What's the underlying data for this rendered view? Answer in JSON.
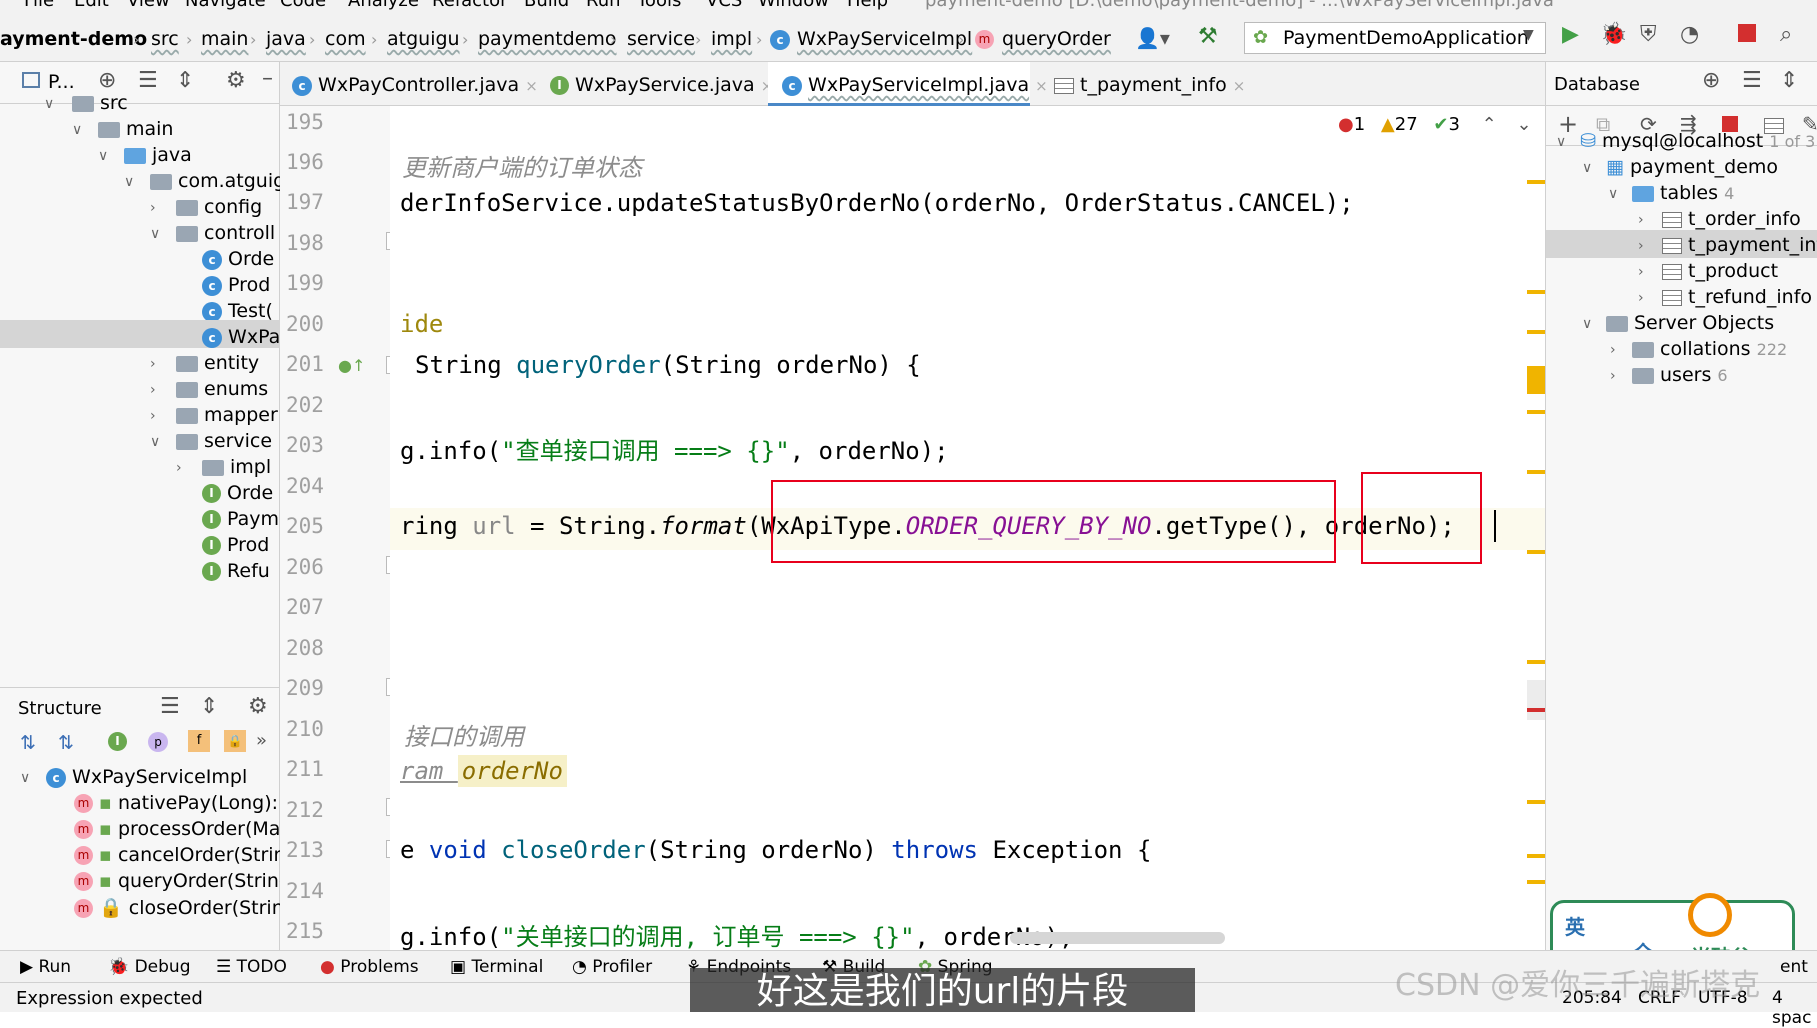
{
  "menubar": {
    "items": [
      "File",
      "Edit",
      "View",
      "Navigate",
      "Code",
      "Analyze",
      "Refactor",
      "Build",
      "Run",
      "Tools",
      "VCS",
      "Window",
      "Help"
    ],
    "title": "payment-demo [D:\\demo\\payment-demo] - ...\\WxPayServiceImpl.java"
  },
  "breadcrumb": {
    "items": [
      "ayment-demo",
      "src",
      "main",
      "java",
      "com",
      "atguigu",
      "paymentdemo",
      "service",
      "impl",
      "WxPayServiceImpl",
      "queryOrder"
    ]
  },
  "run_config": "PaymentDemoApplication",
  "project_panel": {
    "title": "P...",
    "tree": [
      {
        "label": "src",
        "depth": 0
      },
      {
        "label": "main",
        "depth": 1
      },
      {
        "label": "java",
        "depth": 2
      },
      {
        "label": "com.atguig",
        "depth": 3
      },
      {
        "label": "config",
        "depth": 4
      },
      {
        "label": "controll",
        "depth": 4
      },
      {
        "label": "Orde",
        "depth": 5
      },
      {
        "label": "Prod",
        "depth": 5
      },
      {
        "label": "Test(",
        "depth": 5
      },
      {
        "label": "WxPa",
        "depth": 5
      },
      {
        "label": "entity",
        "depth": 4
      },
      {
        "label": "enums",
        "depth": 4
      },
      {
        "label": "mapper",
        "depth": 4
      },
      {
        "label": "service",
        "depth": 4
      },
      {
        "label": "impl",
        "depth": 5
      },
      {
        "label": "Orde",
        "depth": 5
      },
      {
        "label": "Paym",
        "depth": 5
      },
      {
        "label": "Prod",
        "depth": 5
      },
      {
        "label": "Refu",
        "depth": 5
      }
    ]
  },
  "structure_panel": {
    "title": "Structure",
    "root": "WxPayServiceImpl",
    "members": [
      "nativePay(Long): I",
      "processOrder(Ma",
      "cancelOrder(Strin",
      "queryOrder(String",
      "closeOrder(String"
    ]
  },
  "editor": {
    "tabs": [
      "WxPayController.java",
      "WxPayService.java",
      "WxPayServiceImpl.java",
      "t_payment_info"
    ],
    "inspections": {
      "errors": "1",
      "warnings": "27",
      "ok": "3"
    },
    "line_numbers": [
      "195",
      "196",
      "197",
      "198",
      "199",
      "200",
      "201",
      "202",
      "203",
      "204",
      "205",
      "206",
      "207",
      "208",
      "209",
      "210",
      "211",
      "212",
      "213",
      "214",
      "215"
    ],
    "code": {
      "l196": "更新商户端的订单状态",
      "l197": "derInfoService.updateStatusByOrderNo(orderNo, OrderStatus.CANCEL);",
      "l200": "ide",
      "l201_kw": "String ",
      "l201_fn": "queryOrder",
      "l201_rest": "(String orderNo) {",
      "l203_a": "g.info(",
      "l203_str": "\"查单接口调用 ===> {}\"",
      "l203_b": ", orderNo);",
      "l205_a": "ring ",
      "l205_var": "url",
      "l205_b": " = String.",
      "l205_fmt": "format",
      "l205_c": "(WxApiType.",
      "l205_const": "ORDER_QUERY_BY_NO",
      "l205_d": ".getType(), orderNo);",
      "l210": "接口的调用",
      "l211_a": "ram ",
      "l211_b": "orderNo",
      "l213_a": "e ",
      "l213_kw": "void ",
      "l213_fn": "closeOrder",
      "l213_b": "(String orderNo) ",
      "l213_kw2": "throws",
      "l213_c": " Exception {",
      "l215_a": "g.info(",
      "l215_str": "\"关单接口的调用, 订单号 ===> {}\"",
      "l215_b": ", orderNo);"
    }
  },
  "database_panel": {
    "title": "Database",
    "connection": "mysql@localhost",
    "connection_count": "1 of 3",
    "schema": "payment_demo",
    "tables_label": "tables",
    "tables_count": "4",
    "tables": [
      "t_order_info",
      "t_payment_info",
      "t_product",
      "t_refund_info"
    ],
    "server_objects": "Server Objects",
    "collations": "collations",
    "collations_count": "222",
    "users": "users",
    "users_count": "6"
  },
  "tool_windows": [
    "Run",
    "Debug",
    "TODO",
    "Problems",
    "Terminal",
    "Profiler",
    "Endpoints",
    "Build",
    "Spring"
  ],
  "status": {
    "message": "Expression expected",
    "position": "205:84",
    "line_sep": "CRLF",
    "encoding": "UTF-8",
    "indent": "4 spac",
    "event": "ent"
  },
  "subtitle": "好这是我们的url的片段",
  "watermark": "CSDN @爱你三千遍斯塔克",
  "ime": {
    "lang": "英",
    "mode": "全",
    "brand": "尚硅谷"
  },
  "colors": {
    "accent": "#3d8fd6",
    "highlight_box": "#e8001c",
    "warning": "#f0b400"
  }
}
